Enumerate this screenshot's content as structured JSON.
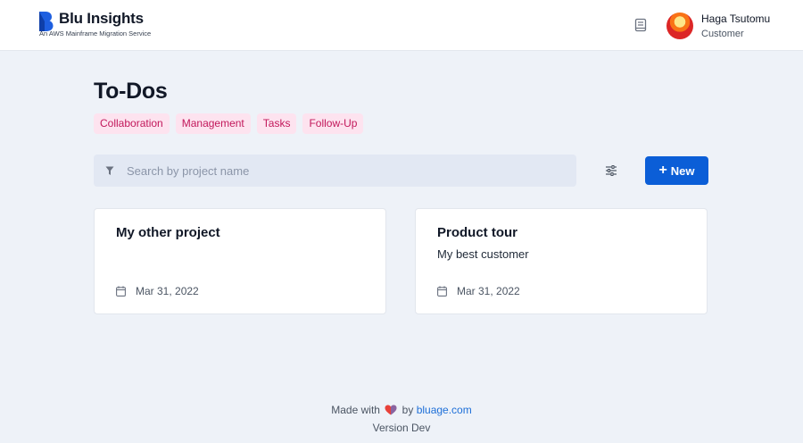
{
  "header": {
    "brand_title": "Blu Insights",
    "brand_subtitle": "An AWS Mainframe Migration Service",
    "user_name": "Haga Tsutomu",
    "user_role": "Customer"
  },
  "page": {
    "title": "To-Dos",
    "tags": [
      "Collaboration",
      "Management",
      "Tasks",
      "Follow-Up"
    ]
  },
  "toolbar": {
    "search_placeholder": "Search by project name",
    "search_value": "",
    "new_label": "New"
  },
  "cards": [
    {
      "title": "My other project",
      "subtitle": "",
      "date": "Mar 31, 2022"
    },
    {
      "title": "Product tour",
      "subtitle": "My best customer",
      "date": "Mar 31, 2022"
    }
  ],
  "footer": {
    "made_with": "Made with",
    "by": "by",
    "link": "bluage.com",
    "version": "Version Dev"
  },
  "icons": {
    "logo": "blu-logo-icon",
    "docs": "book-icon",
    "search": "filter-funnel-icon",
    "filters": "sliders-icon",
    "new": "plus-icon",
    "date": "calendar-icon",
    "heart": "heart-icon"
  },
  "colors": {
    "accent": "#0b5ed7",
    "tag_bg": "#fde3ef",
    "tag_text": "#c2185b",
    "background": "#eef2f8",
    "link": "#1d6fd8"
  }
}
